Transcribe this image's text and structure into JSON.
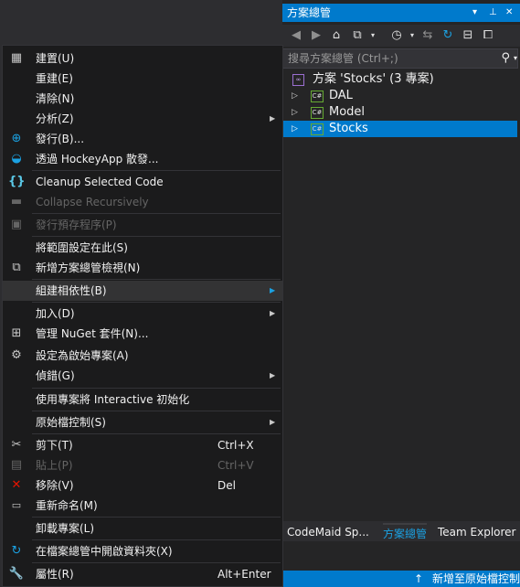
{
  "solution_explorer": {
    "title": "方案總管",
    "title_buttons": [
      "▾",
      "⊥",
      "✕"
    ],
    "search_placeholder": "搜尋方案總管 (Ctrl+;)",
    "tree": {
      "solution_label": "方案 'Stocks' (3 專案)",
      "projects": [
        {
          "name": "DAL",
          "icon": "C#"
        },
        {
          "name": "Model",
          "icon": "C#"
        },
        {
          "name": "Stocks",
          "icon": "C#"
        }
      ]
    },
    "tabs": [
      "CodeMaid Sp...",
      "方案總管",
      "Team Explorer"
    ],
    "status_text": "新增至原始檔控制"
  },
  "context_menu": {
    "items": [
      {
        "label": "建置(U)"
      },
      {
        "label": "重建(E)"
      },
      {
        "label": "清除(N)"
      },
      {
        "label": "分析(Z)"
      },
      {
        "label": "發行(B)..."
      },
      {
        "label": "透過 HockeyApp 散發..."
      },
      {
        "label": "Cleanup Selected Code"
      },
      {
        "label": "Collapse Recursively"
      },
      {
        "label": "發行預存程序(P)"
      },
      {
        "label": "將範圍設定在此(S)"
      },
      {
        "label": "新增方案總管檢視(N)"
      },
      {
        "label": "組建相依性(B)"
      },
      {
        "label": "加入(D)"
      },
      {
        "label": "管理 NuGet 套件(N)..."
      },
      {
        "label": "設定為啟始專案(A)"
      },
      {
        "label": "偵錯(G)"
      },
      {
        "label": "使用專案將 Interactive 初始化"
      },
      {
        "label": "原始檔控制(S)"
      },
      {
        "label": "剪下(T)",
        "shortcut": "Ctrl+X"
      },
      {
        "label": "貼上(P)",
        "shortcut": "Ctrl+V"
      },
      {
        "label": "移除(V)",
        "shortcut": "Del"
      },
      {
        "label": "重新命名(M)"
      },
      {
        "label": "卸載專案(L)"
      },
      {
        "label": "在檔案總管中開啟資料夾(X)"
      },
      {
        "label": "屬性(R)",
        "shortcut": "Alt+Enter"
      }
    ]
  },
  "colors": {
    "accent": "#007acc",
    "background": "#2d2d30",
    "menu_background": "#1b1b1c",
    "disabled_text": "#656565"
  }
}
